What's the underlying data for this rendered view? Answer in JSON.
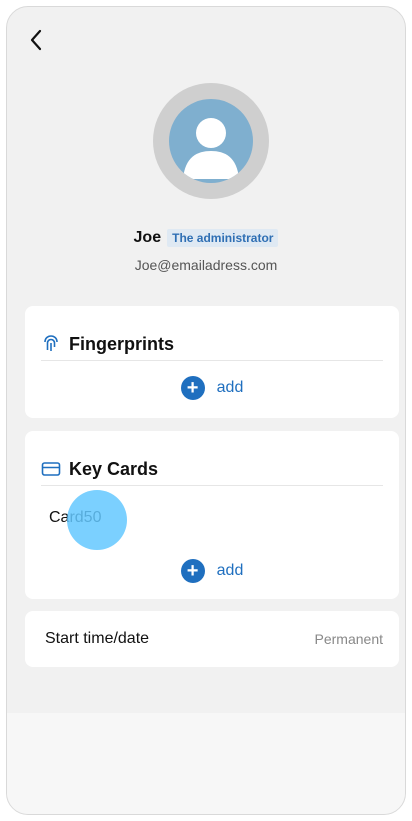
{
  "profile": {
    "name": "Joe",
    "role": "The administrator",
    "email": "Joe@emailadress.com"
  },
  "fingerprints": {
    "title": "Fingerprints",
    "icon": "fingerprint-icon",
    "add_label": "add"
  },
  "key_cards": {
    "title": "Key Cards",
    "icon": "card-icon",
    "items": [
      "Card50"
    ],
    "add_label": "add"
  },
  "access_time": {
    "label": "Start time/date",
    "value": "Permanent"
  },
  "colors": {
    "accent": "#1f6fbf",
    "background": "#f1f1f1",
    "badge_bg": "#dfe9f3"
  }
}
